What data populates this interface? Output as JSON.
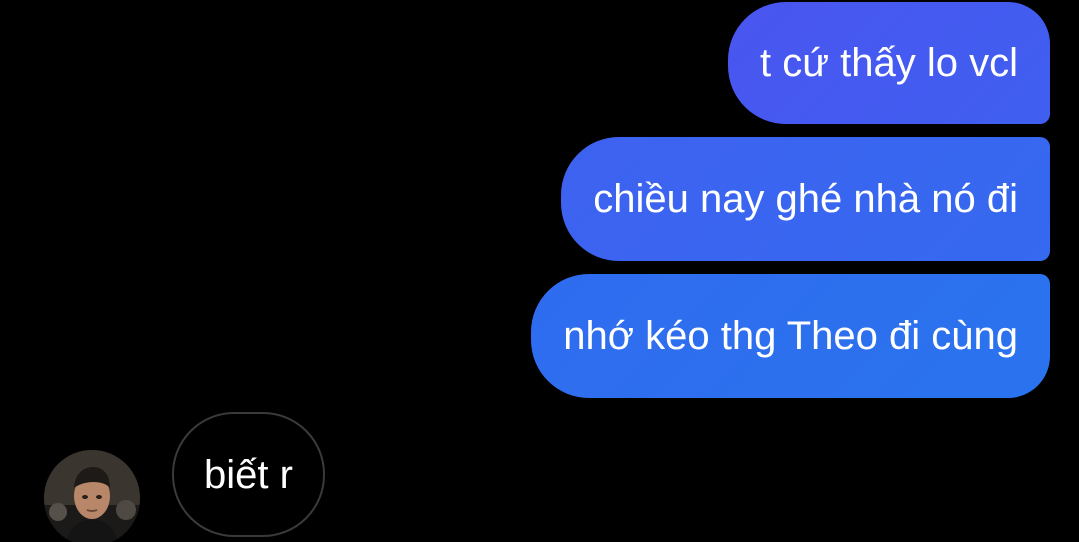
{
  "conversation": {
    "outgoing": [
      {
        "text": "t cứ thấy lo vcl"
      },
      {
        "text": "chiều nay ghé nhà nó đi"
      },
      {
        "text": "nhớ kéo thg Theo đi cùng"
      }
    ],
    "incoming": [
      {
        "text": "biết r"
      }
    ]
  },
  "colors": {
    "background": "#000000",
    "outgoing_bubble_top": "#4a55f0",
    "outgoing_bubble_bottom": "#2a73ee",
    "incoming_border": "#3a3a3a",
    "text": "#ffffff"
  },
  "icons": {
    "avatar": "contact-avatar-photo"
  }
}
